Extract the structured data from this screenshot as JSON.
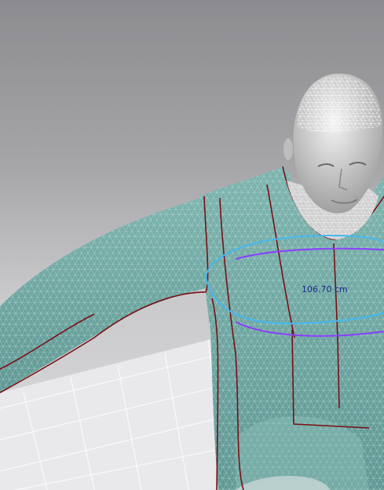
{
  "viewport": {
    "measurement_label": "106.70 cm"
  },
  "colors": {
    "garment_fill": "#6fa6a2",
    "seam_line": "#7a0f14",
    "measure_ring_cyan": "#45b8f0",
    "measure_ring_purple": "#8b3dff",
    "label_text": "#1a2a86",
    "grid_line": "#ffffff"
  },
  "icons": {
    "avatar": "3d-avatar-mesh",
    "garment": "garment-mesh"
  }
}
